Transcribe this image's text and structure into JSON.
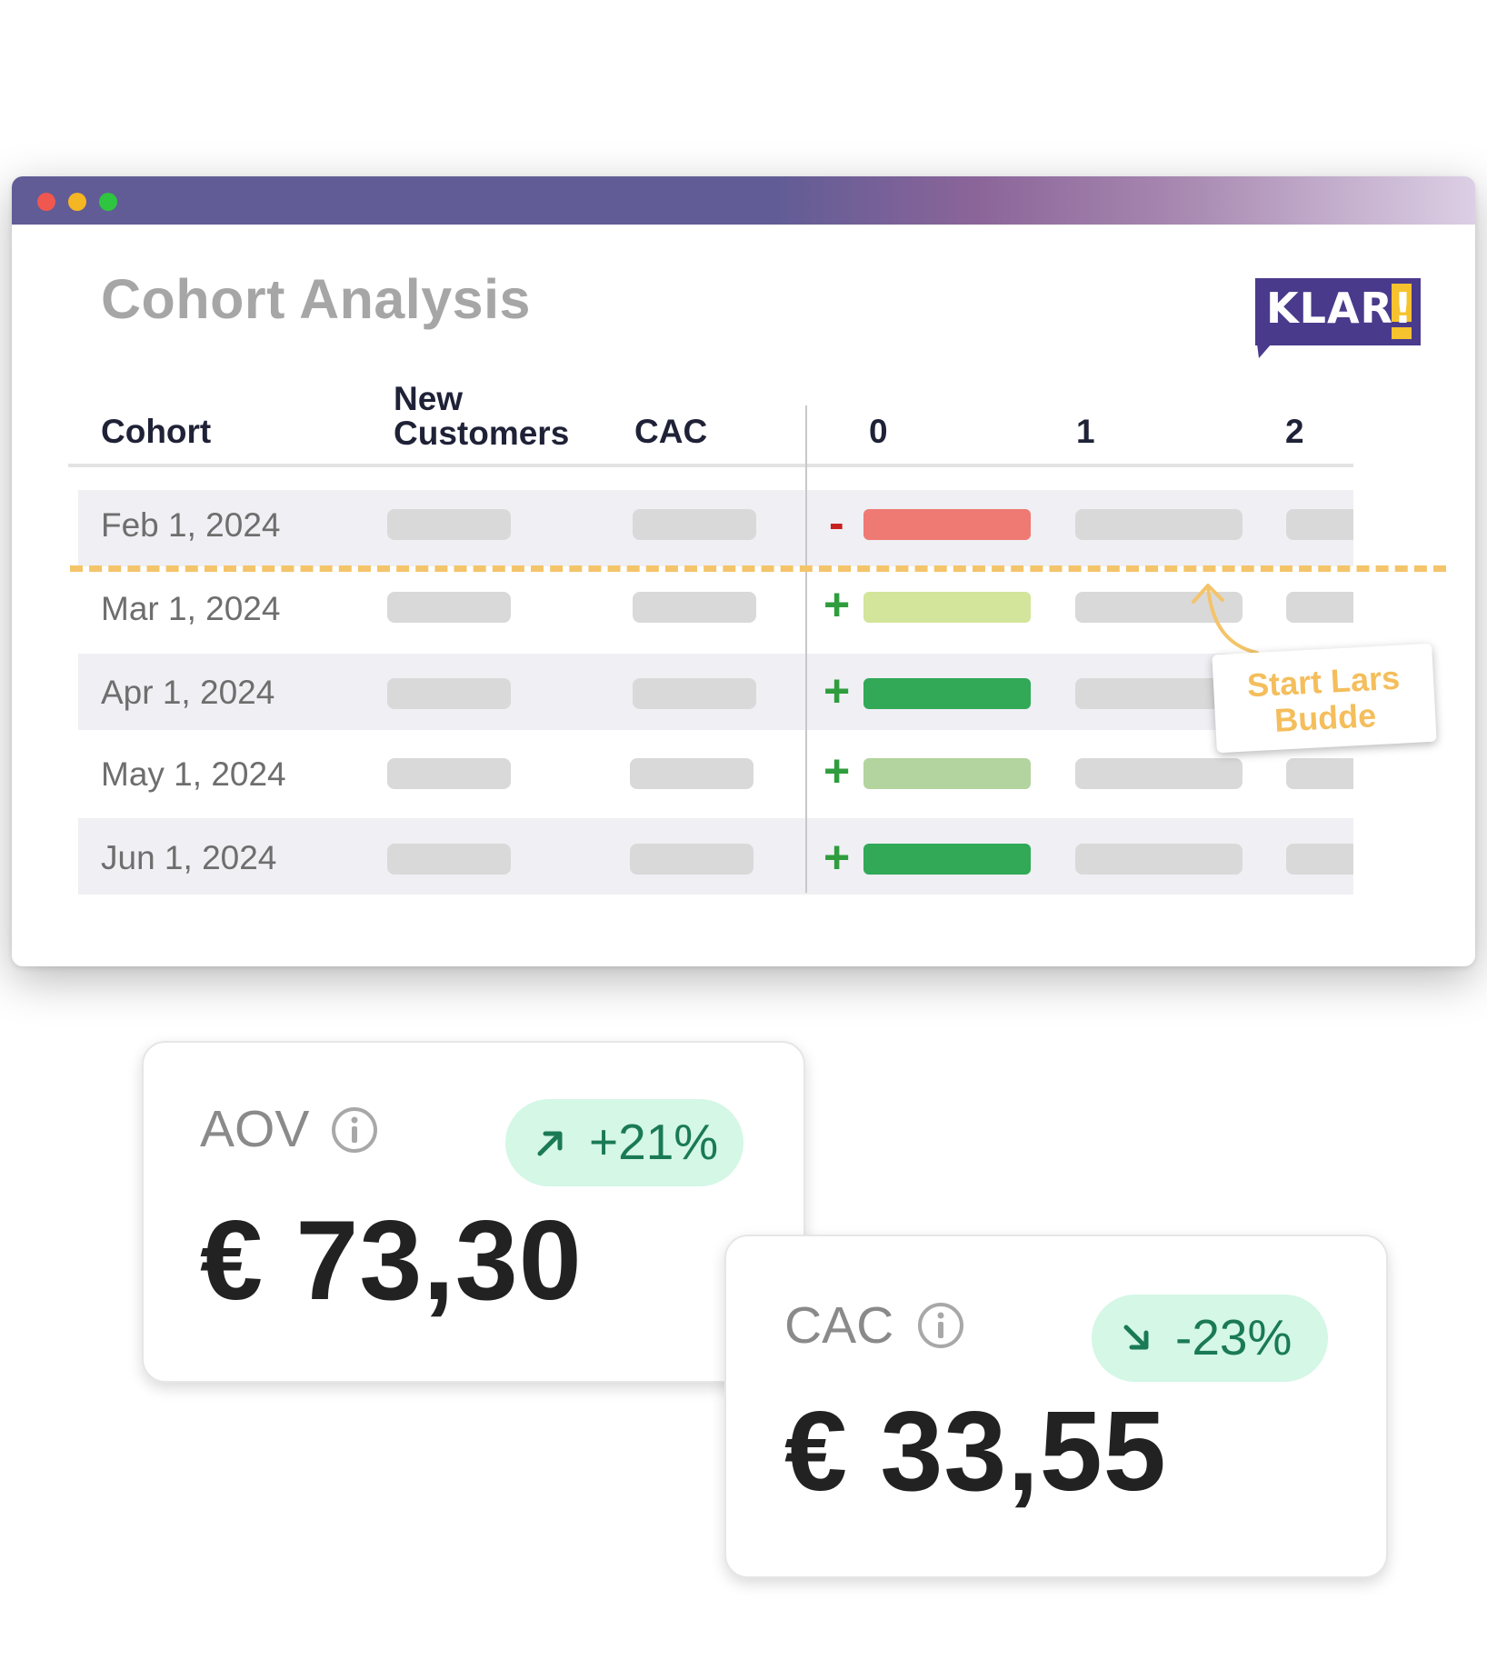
{
  "window": {
    "title": "Cohort Analysis",
    "logo_text": "KLAR!"
  },
  "table": {
    "headers": {
      "cohort": "Cohort",
      "new_customers_line1": "New",
      "new_customers_line2": "Customers",
      "cac": "CAC",
      "col0": "0",
      "col1": "1",
      "col2": "2"
    },
    "rows": [
      {
        "date": "Feb 1, 2024",
        "sign": "-"
      },
      {
        "date": "Mar 1, 2024",
        "sign": "+"
      },
      {
        "date": "Apr 1, 2024",
        "sign": "+"
      },
      {
        "date": "May 1, 2024",
        "sign": "+"
      },
      {
        "date": "Jun 1, 2024",
        "sign": "+"
      }
    ]
  },
  "annotation": {
    "line1": "Start Lars",
    "line2": "Budde"
  },
  "colors": {
    "negative": "#ef7a73",
    "neg_sign": "#c62020",
    "light_green": "#d3e59b",
    "mid_green": "#b3d49e",
    "green": "#31a957",
    "pos_sign": "#2f9d3e",
    "klar_purple": "#4a3a8c",
    "klar_yellow": "#f6c22e"
  },
  "cards": {
    "aov": {
      "label": "AOV",
      "change": "+21%",
      "change_icon": "arrow-up-right-icon",
      "value": "€ 73,30"
    },
    "cac": {
      "label": "CAC",
      "change": "-23%",
      "change_icon": "arrow-down-right-icon",
      "value": "€ 33,55"
    }
  }
}
